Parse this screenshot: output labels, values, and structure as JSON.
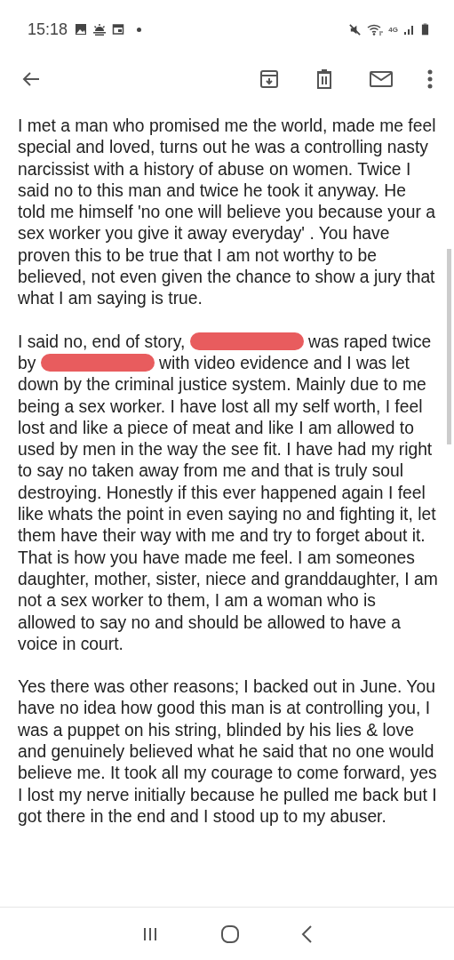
{
  "status_bar": {
    "time": "15:18",
    "network": "4G"
  },
  "paragraphs": [
    {
      "segments": [
        {
          "kind": "text",
          "text": "I met a man who promised me the world, made me feel special and loved, turns out he was a controlling  nasty narcissist with a history of abuse on women. Twice I said no to this man and twice he took it anyway. He told me himself 'no one will believe you because your a sex worker you give it away everyday' . You have proven this to be true that I am not worthy to be believed, not even given the chance to show a jury that what I am saying is true."
        }
      ]
    },
    {
      "segments": [
        {
          "kind": "text",
          "text": "I said no, end of story,"
        },
        {
          "kind": "redaction"
        },
        {
          "kind": "text",
          "text": "was raped twice by"
        },
        {
          "kind": "redaction"
        },
        {
          "kind": "text",
          "text": "with video evidence and I was let down by the criminal justice system. Mainly due to me being a sex worker. I have lost all my self worth, I feel lost and like a piece of meat and like I am allowed to used by men in the way the see fit. I have had my right to say no taken away from me and that is truly soul destroying. Honestly if this ever happened again I feel like whats the point in even saying no and fighting it, let them have their way with me and try to forget about it. That is how you have made me feel. I am someones daughter, mother, sister, niece and granddaughter, I am not a sex worker to them, I am a woman who is allowed to say no and should be allowed to have a voice in court."
        }
      ]
    },
    {
      "segments": [
        {
          "kind": "text",
          "text": "Yes there was other reasons; I backed out in June. You have no idea how good this man is at controlling you, I was a puppet on his string, blinded by his lies & love and genuinely believed what he said that no one would believe me. It took all my courage to come forward, yes I lost my nerve initially because he pulled me back but I got there in the end and I stood up to my abuser."
        }
      ]
    }
  ]
}
